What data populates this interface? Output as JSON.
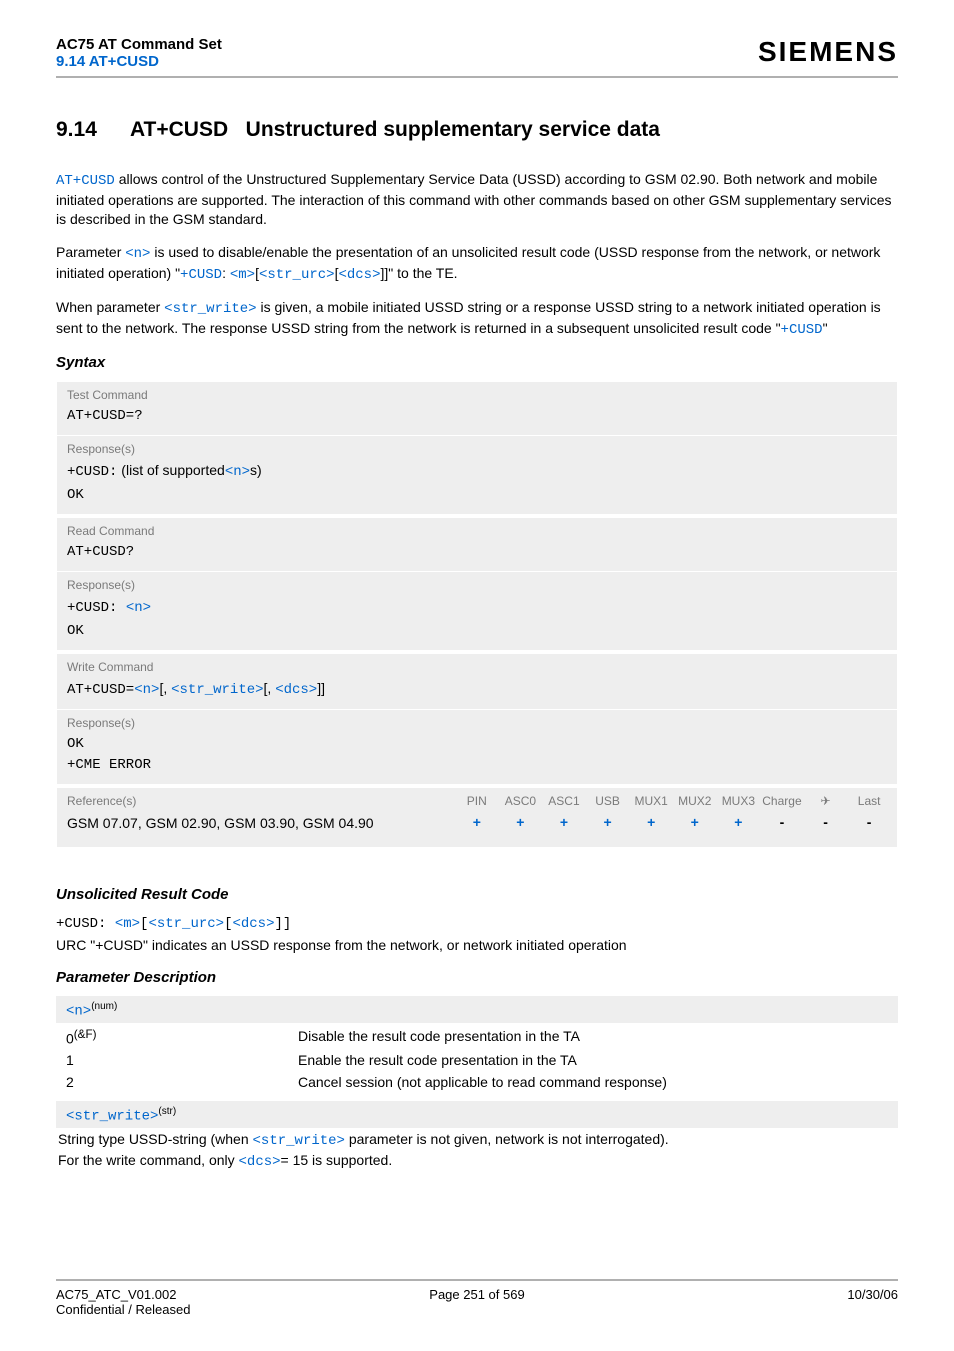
{
  "header": {
    "line1": "AC75 AT Command Set",
    "line2": "9.14 AT+CUSD",
    "brand": "SIEMENS"
  },
  "title": {
    "num": "9.14",
    "cmd": "AT+CUSD",
    "desc": "Unstructured supplementary service data"
  },
  "intro": {
    "p1_a": "AT+CUSD",
    "p1_b": " allows control of the Unstructured Supplementary Service Data (USSD) according to GSM 02.90. Both network and mobile initiated operations are supported. The interaction of this command with other commands based on other GSM supplementary services is described in the GSM standard.",
    "p2_a": "Parameter ",
    "p2_n": "<n>",
    "p2_b": " is used to disable/enable the presentation of an unsolicited result code (USSD response from the network, or network initiated operation) \"",
    "p2_cusd": "+CUSD",
    "p2_colon": ": ",
    "p2_m": "<m>",
    "p2_br1": "[",
    "p2_str": "<str_urc>",
    "p2_br2": "[",
    "p2_dcs": "<dcs>",
    "p2_br3": "]]\" to the TE.",
    "p3_a": "When parameter ",
    "p3_sw": "<str_write>",
    "p3_b": " is given, a mobile initiated USSD string or a response USSD string to a network initiated operation is sent to the network. The response USSD string from the network is returned in a subsequent unsolicited result code \"",
    "p3_cusd": "+CUSD",
    "p3_c": "\""
  },
  "syntax_label": "Syntax",
  "test_cmd": {
    "label": "Test Command",
    "cmd": "AT+CUSD=?",
    "resp_label": "Response(s)",
    "resp_a": "+CUSD:",
    "resp_b": " (list of supported",
    "resp_n": "<n>",
    "resp_c": "s)",
    "ok": "OK"
  },
  "read_cmd": {
    "label": "Read Command",
    "cmd": "AT+CUSD?",
    "resp_label": "Response(s)",
    "resp_a": "+CUSD: ",
    "resp_n": "<n>",
    "ok": "OK"
  },
  "write_cmd": {
    "label": "Write Command",
    "cmd_a": "AT+CUSD=",
    "cmd_n": "<n>",
    "cmd_b": "[, ",
    "cmd_sw": "<str_write>",
    "cmd_c": "[, ",
    "cmd_dcs": "<dcs>",
    "cmd_d": "]]",
    "resp_label": "Response(s)",
    "ok": "OK",
    "err": "+CME ERROR"
  },
  "reference": {
    "label": "Reference(s)",
    "cols": [
      "PIN",
      "ASC0",
      "ASC1",
      "USB",
      "MUX1",
      "MUX2",
      "MUX3",
      "Charge",
      "✈",
      "Last"
    ],
    "text": "GSM 07.07, GSM 02.90, GSM 03.90, GSM 04.90",
    "vals": [
      "+",
      "+",
      "+",
      "+",
      "+",
      "+",
      "+",
      "-",
      "-",
      "-"
    ]
  },
  "urc": {
    "heading": "Unsolicited Result Code",
    "line_a": "+CUSD: ",
    "line_m": "<m>",
    "line_b1": "[",
    "line_str": "<str_urc>",
    "line_b2": "[",
    "line_dcs": "<dcs>",
    "line_b3": "]]",
    "desc": "URC \"+CUSD\" indicates an USSD response from the network, or network initiated operation"
  },
  "param": {
    "heading": "Parameter Description",
    "n_param": "<n>",
    "n_sup": "(num)",
    "rows": [
      {
        "k_a": "0",
        "k_sup": "(&F)",
        "v": "Disable the result code presentation in the TA"
      },
      {
        "k_a": "1",
        "k_sup": "",
        "v": "Enable the result code presentation in the TA"
      },
      {
        "k_a": "2",
        "k_sup": "",
        "v": "Cancel session (not applicable to read command response)"
      }
    ],
    "sw_param": "<str_write>",
    "sw_sup": "(str)",
    "sw_desc_a": "String type USSD-string (when ",
    "sw_desc_sw": "<str_write>",
    "sw_desc_b": " parameter is not given, network is not interrogated).",
    "sw_desc2_a": "For the write command, only ",
    "sw_desc2_dcs": "<dcs>",
    "sw_desc2_b": "= 15 is supported."
  },
  "footer": {
    "left1": "AC75_ATC_V01.002",
    "left2": "Confidential / Released",
    "center": "Page 251 of 569",
    "right": "10/30/06"
  }
}
